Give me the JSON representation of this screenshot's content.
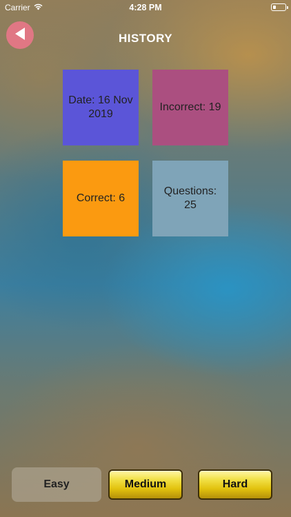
{
  "status_bar": {
    "carrier": "Carrier",
    "time": "4:28 PM"
  },
  "header": {
    "title": "HISTORY",
    "back_icon": "back-arrow-icon",
    "back_color": "#e07784"
  },
  "stats": {
    "date": "Date: 16 Nov 2019",
    "incorrect": "Incorrect: 19",
    "correct": "Correct: 6",
    "questions": "Questions: 25"
  },
  "difficulty": {
    "easy": "Easy",
    "medium": "Medium",
    "hard": "Hard",
    "selected": "Easy"
  }
}
